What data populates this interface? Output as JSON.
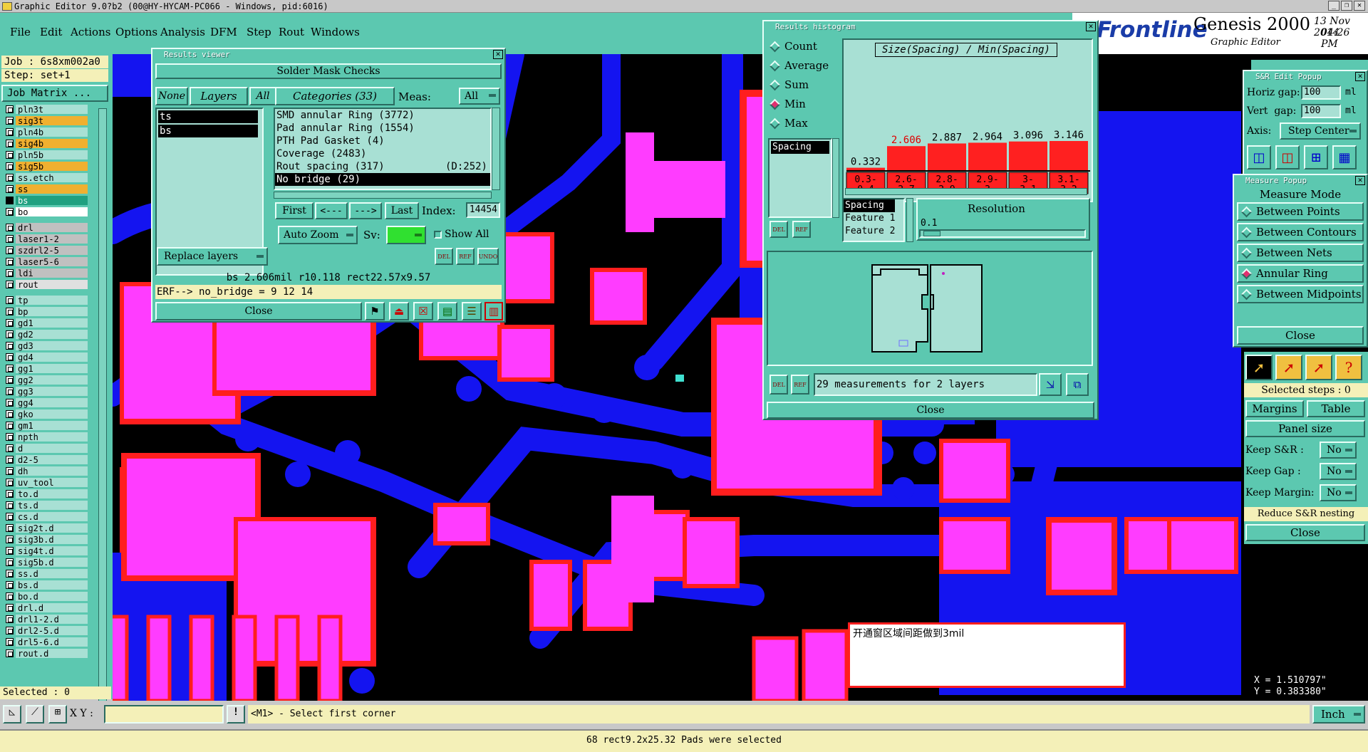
{
  "titlebar": {
    "text": "Graphic Editor 9.0?b2 (00@HY-HYCAM-PC066 - Windows, pid:6016)"
  },
  "menu": [
    "File",
    "Edit",
    "Actions",
    "Options",
    "Analysis",
    "DFM",
    "Step",
    "Rout",
    "Windows"
  ],
  "brand": {
    "logo": "Frontline",
    "product": "Genesis 2000",
    "subtitle": "Graphic Editor",
    "date": "13 Nov 2014",
    "time": "04:26 PM"
  },
  "job": {
    "job": "Job : 6s8xm002a0",
    "step": "Step: set+1",
    "matrix_btn": "Job Matrix ..."
  },
  "layers": [
    {
      "name": "pln3t",
      "color": "#a8e0d4"
    },
    {
      "name": "sig3t",
      "color": "#f0b030"
    },
    {
      "name": "pln4b",
      "color": "#a8e0d4"
    },
    {
      "name": "sig4b",
      "color": "#f0b030"
    },
    {
      "name": "pln5b",
      "color": "#a8e0d4"
    },
    {
      "name": "sig5b",
      "color": "#f0b030"
    },
    {
      "name": "ss.etch",
      "color": "#a8e0d4"
    },
    {
      "name": "ss",
      "color": "#f0b030"
    },
    {
      "name": "bs",
      "color": "#20a080"
    },
    {
      "name": "bo",
      "color": "#ffffff"
    },
    {
      "name": "drl",
      "color": "#c0c0c0"
    },
    {
      "name": "laser1-2",
      "color": "#c0c0c0"
    },
    {
      "name": "szdrl2-5",
      "color": "#c0c0c0"
    },
    {
      "name": "laser5-6",
      "color": "#c0c0c0"
    },
    {
      "name": "ldi",
      "color": "#c0c0c0"
    },
    {
      "name": "rout",
      "color": "#e0e0e0"
    },
    {
      "name": "tp",
      "color": "#a8e0d4"
    },
    {
      "name": "bp",
      "color": "#a8e0d4"
    },
    {
      "name": "gd1",
      "color": "#a8e0d4"
    },
    {
      "name": "gd2",
      "color": "#a8e0d4"
    },
    {
      "name": "gd3",
      "color": "#a8e0d4"
    },
    {
      "name": "gd4",
      "color": "#a8e0d4"
    },
    {
      "name": "gg1",
      "color": "#a8e0d4"
    },
    {
      "name": "gg2",
      "color": "#a8e0d4"
    },
    {
      "name": "gg3",
      "color": "#a8e0d4"
    },
    {
      "name": "gg4",
      "color": "#a8e0d4"
    },
    {
      "name": "gko",
      "color": "#a8e0d4"
    },
    {
      "name": "gm1",
      "color": "#a8e0d4"
    },
    {
      "name": "npth",
      "color": "#a8e0d4"
    },
    {
      "name": "d",
      "color": "#a8e0d4"
    },
    {
      "name": "d2-5",
      "color": "#a8e0d4"
    },
    {
      "name": "dh",
      "color": "#a8e0d4"
    },
    {
      "name": "uv_tool",
      "color": "#a8e0d4"
    },
    {
      "name": "to.d",
      "color": "#a8e0d4"
    },
    {
      "name": "ts.d",
      "color": "#a8e0d4"
    },
    {
      "name": "cs.d",
      "color": "#a8e0d4"
    },
    {
      "name": "sig2t.d",
      "color": "#a8e0d4"
    },
    {
      "name": "sig3b.d",
      "color": "#a8e0d4"
    },
    {
      "name": "sig4t.d",
      "color": "#a8e0d4"
    },
    {
      "name": "sig5b.d",
      "color": "#a8e0d4"
    },
    {
      "name": "ss.d",
      "color": "#a8e0d4"
    },
    {
      "name": "bs.d",
      "color": "#a8e0d4"
    },
    {
      "name": "bo.d",
      "color": "#a8e0d4"
    },
    {
      "name": "drl.d",
      "color": "#a8e0d4"
    },
    {
      "name": "drl1-2.d",
      "color": "#a8e0d4"
    },
    {
      "name": "drl2-5.d",
      "color": "#a8e0d4"
    },
    {
      "name": "drl5-6.d",
      "color": "#a8e0d4"
    },
    {
      "name": "rout.d",
      "color": "#a8e0d4"
    }
  ],
  "selected_count": "Selected : 0",
  "results_viewer": {
    "title": "Results viewer",
    "header": "Solder Mask Checks",
    "none_btn": "None",
    "layers_btn": "Layers",
    "all_btn": "All",
    "categories_btn": "Categories (33)",
    "meas_label": "Meas:",
    "meas_value": "All",
    "layer_items": [
      "ts",
      "bs"
    ],
    "categories": [
      "SMD annular Ring (3772)",
      "Pad annular Ring (1554)",
      "PTH Pad Gasket (4)",
      "Coverage (2483)",
      "Rout spacing (317)",
      "No bridge (29)"
    ],
    "rout_extra": "(D:252)",
    "first": "First",
    "prev": "<---",
    "next": "--->",
    "last": "Last",
    "index_label": "Index:",
    "index_value": "14454",
    "replace": "Replace layers",
    "autozoom": "Auto Zoom",
    "sv": "Sv:",
    "show_all": "Show All",
    "info": "bs 2.606mil   r10.118   rect22.57x9.57",
    "erf": "ERF--> no_bridge = 9 12 14",
    "close": "Close"
  },
  "histogram": {
    "title": "Results histogram",
    "modes": [
      "Count",
      "Average",
      "Sum",
      "Min",
      "Max"
    ],
    "selected_mode": "Min",
    "heading": "Size(Spacing) / Min(Spacing)",
    "list_item": "Spacing",
    "resolution_label": "Resolution",
    "resolution_value": "0.1",
    "features": [
      "Spacing",
      "Feature 1",
      "Feature 2"
    ],
    "summary": "29 measurements for 2 layers",
    "close": "Close"
  },
  "chart_data": {
    "type": "bar",
    "categories": [
      "0.3-0.4",
      "2.6-2.7",
      "2.8-2.9",
      "2.9-3",
      "3-3.1",
      "3.1-3.2"
    ],
    "values": [
      0.332,
      2.606,
      2.887,
      2.964,
      3.096,
      3.146
    ],
    "labels": [
      "0.332",
      "2.606",
      "2.887",
      "2.964",
      "3.096",
      "3.146"
    ],
    "bar_color": "#ff2020"
  },
  "sr_popup": {
    "title": "S&R Edit Popup",
    "hgap_label": "Horiz gap:",
    "hgap": "100",
    "hgap_unit": "ml",
    "vgap_label": "Vert  gap:",
    "vgap": "100",
    "vgap_unit": "ml",
    "axis_label": "Axis:",
    "axis_value": "Step Center"
  },
  "measure_popup": {
    "title": "Measure Popup",
    "header": "Measure Mode",
    "modes": [
      "Between Points",
      "Between Contours",
      "Between Nets",
      "Annular Ring",
      "Between Midpoints"
    ],
    "selected": "Annular Ring",
    "close": "Close"
  },
  "right_panel": {
    "selected_steps": "Selected steps : 0",
    "margins": "Margins",
    "table": "Table",
    "panel_size": "Panel size",
    "keep_sr": "Keep S&R :",
    "keep_gap": "Keep Gap :",
    "keep_margin": "Keep Margin:",
    "no": "No",
    "reduce": "Reduce S&R nesting",
    "close": "Close"
  },
  "coords": {
    "x": "X = 1.510797\"",
    "y": "Y = 0.383380\""
  },
  "note": "开通窗区域间距做到3mil",
  "cmd": {
    "xy": "X Y :",
    "prompt": "<M1> - Select first corner",
    "unit": "Inch"
  },
  "status": "68 rect9.2x25.32 Pads were selected"
}
